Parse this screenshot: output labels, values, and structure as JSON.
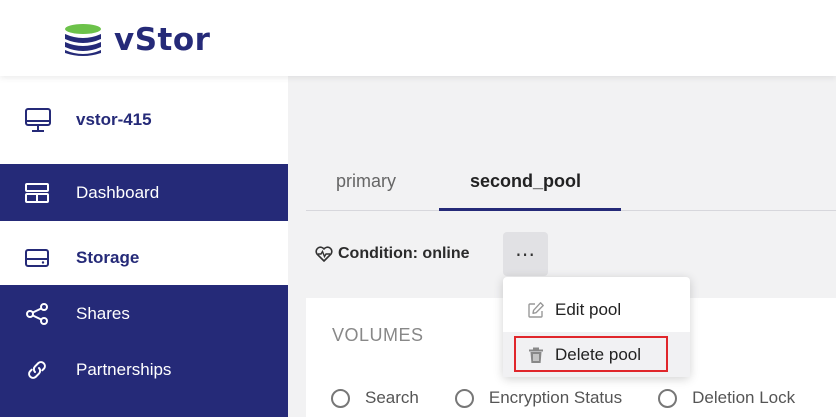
{
  "brand": {
    "name": "vStor",
    "color": "#252a78",
    "accent": "#6cc24a"
  },
  "host": {
    "name": "vstor-415",
    "icon": "monitor-icon"
  },
  "sidebar": {
    "items": [
      {
        "label": "Dashboard",
        "icon": "dashboard-icon",
        "active": false
      },
      {
        "label": "Storage",
        "icon": "storage-icon",
        "active": true
      },
      {
        "label": "Shares",
        "icon": "share-icon",
        "active": false
      },
      {
        "label": "Partnerships",
        "icon": "link-icon",
        "active": false
      }
    ]
  },
  "tabs": [
    {
      "label": "primary",
      "active": false
    },
    {
      "label": "second_pool",
      "active": true
    }
  ],
  "condition": {
    "label": "Condition: online",
    "icon": "heartbeat-icon"
  },
  "more_button": {
    "label": "⋯"
  },
  "volumes": {
    "title": "VOLUMES",
    "filters": [
      "Search",
      "Encryption Status",
      "Deletion Lock"
    ]
  },
  "menu": {
    "items": [
      {
        "label": "Edit pool",
        "icon": "edit-icon"
      },
      {
        "label": "Delete pool",
        "icon": "trash-icon"
      }
    ]
  }
}
